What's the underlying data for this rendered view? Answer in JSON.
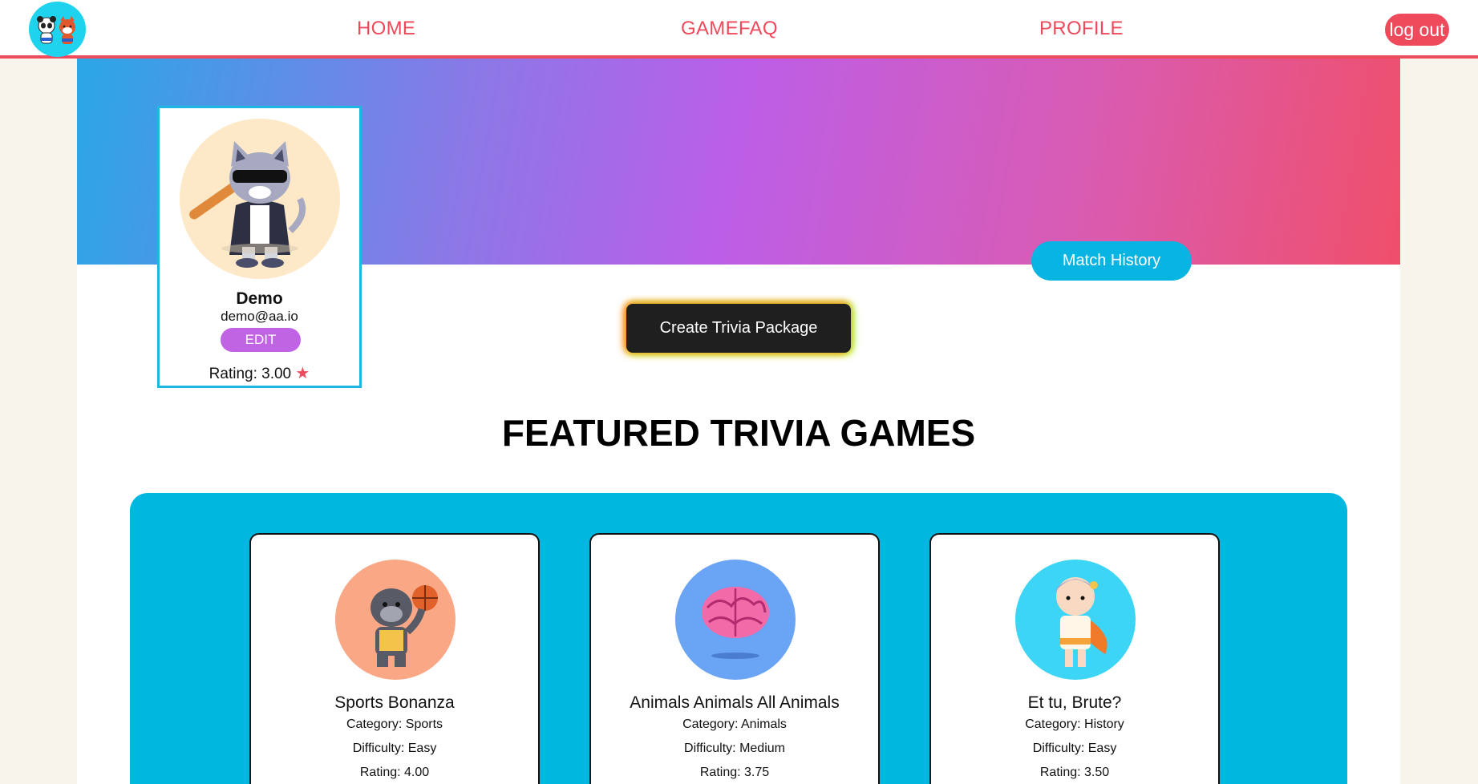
{
  "nav": {
    "home": "HOME",
    "gamefaq": "GAMEFAQ",
    "profile": "PROFILE",
    "logout": "log out",
    "accent_color": "#ef4a5b",
    "logo_icon": "panda-and-red-panda-logo-icon"
  },
  "profile": {
    "name": "Demo",
    "email": "demo@aa.io",
    "edit_label": "EDIT",
    "rating_label": "Rating: 3.00",
    "rating_value": 3.0,
    "rating_icon": "star-icon",
    "avatar_icon": "cool-cat-with-bat-avatar-icon"
  },
  "buttons": {
    "match_history": "Match History",
    "create_trivia": "Create Trivia Package"
  },
  "featured": {
    "title": "FEATURED TRIVIA GAMES",
    "panel_color": "#00b7e0",
    "games": [
      {
        "title": "Sports Bonanza",
        "category": "Category: Sports",
        "difficulty": "Difficulty: Easy",
        "rating": "Rating: 4.00",
        "image_icon": "gorilla-basketball-icon",
        "image_bg": "#f9a785"
      },
      {
        "title": "Animals Animals All Animals",
        "category": "Category: Animals",
        "difficulty": "Difficulty: Medium",
        "rating": "Rating: 3.75",
        "image_icon": "brain-icon",
        "image_bg": "#6aa4f4"
      },
      {
        "title": "Et tu, Brute?",
        "category": "Category: History",
        "difficulty": "Difficulty: Easy",
        "rating": "Rating: 3.50",
        "image_icon": "roman-caesar-character-icon",
        "image_bg": "#3dd5f6"
      }
    ]
  }
}
